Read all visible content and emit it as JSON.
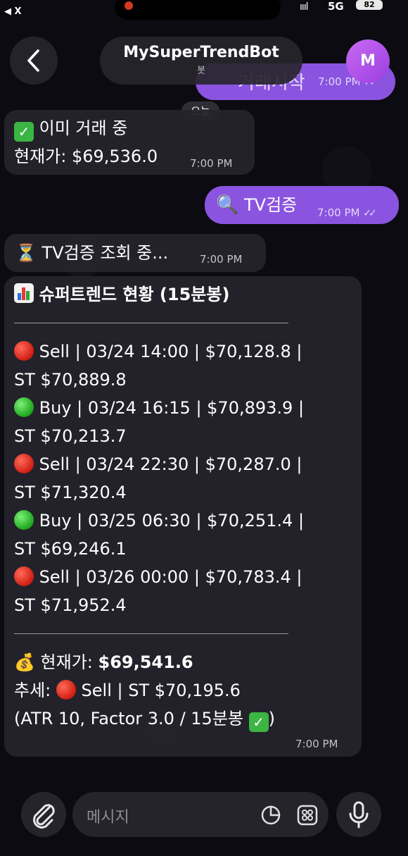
{
  "status": {
    "back_app": "◀ X",
    "signal": "ıııl",
    "network": "5G",
    "battery": "82"
  },
  "header": {
    "title": "MySuperTrendBot",
    "subtitle": "봇",
    "avatar_letter": "M"
  },
  "date_chip": "오늘",
  "messages": {
    "m0_partial": {
      "text": "거래시작",
      "time": "7:00 PM"
    },
    "m1": {
      "line1": "이미 거래 중",
      "line2": "현재가: $69,536.0",
      "time": "7:00 PM"
    },
    "m2": {
      "text": "TV검증",
      "time": "7:00 PM"
    },
    "m3": {
      "text": "TV검증 조회 중...",
      "time": "7:00 PM"
    },
    "m4": {
      "title": "슈퍼트렌드 현황 (15분봉)",
      "signals": [
        {
          "line1": "Sell | 03/24 14:00 | $70,128.8 |",
          "line2": "ST $70,889.8",
          "color": "red"
        },
        {
          "line1": "Buy | 03/24 16:15 | $70,893.9 |",
          "line2": "ST $70,213.7",
          "color": "green"
        },
        {
          "line1": "Sell | 03/24 22:30 | $70,287.0 |",
          "line2": "ST $71,320.4",
          "color": "red"
        },
        {
          "line1": "Buy | 03/25 06:30 | $70,251.4 |",
          "line2": "ST $69,246.1",
          "color": "green"
        },
        {
          "line1": "Sell | 03/26 00:00 | $70,783.4 |",
          "line2": "ST $71,952.4",
          "color": "red"
        }
      ],
      "price_label": "현재가:",
      "price_value": "$69,541.6",
      "trend_label": "추세:",
      "trend_text": "Sell | ST $70,195.6",
      "params": "(ATR 10, Factor 3.0 / 15분봉",
      "params_end": ")",
      "time": "7:00 PM"
    }
  },
  "composer": {
    "placeholder": "메시지"
  },
  "colors": {
    "accent": "#8a54e0",
    "incoming": "#25242c",
    "red": "#d11d12",
    "green": "#1da51b"
  },
  "icons": [
    "back-arrow-icon",
    "check-box-icon",
    "magnifier-icon",
    "hourglass-icon",
    "bar-chart-icon",
    "red-circle-icon",
    "green-circle-icon",
    "money-bag-icon",
    "paperclip-icon",
    "sticker-icon",
    "emoji-grid-icon",
    "microphone-icon"
  ]
}
